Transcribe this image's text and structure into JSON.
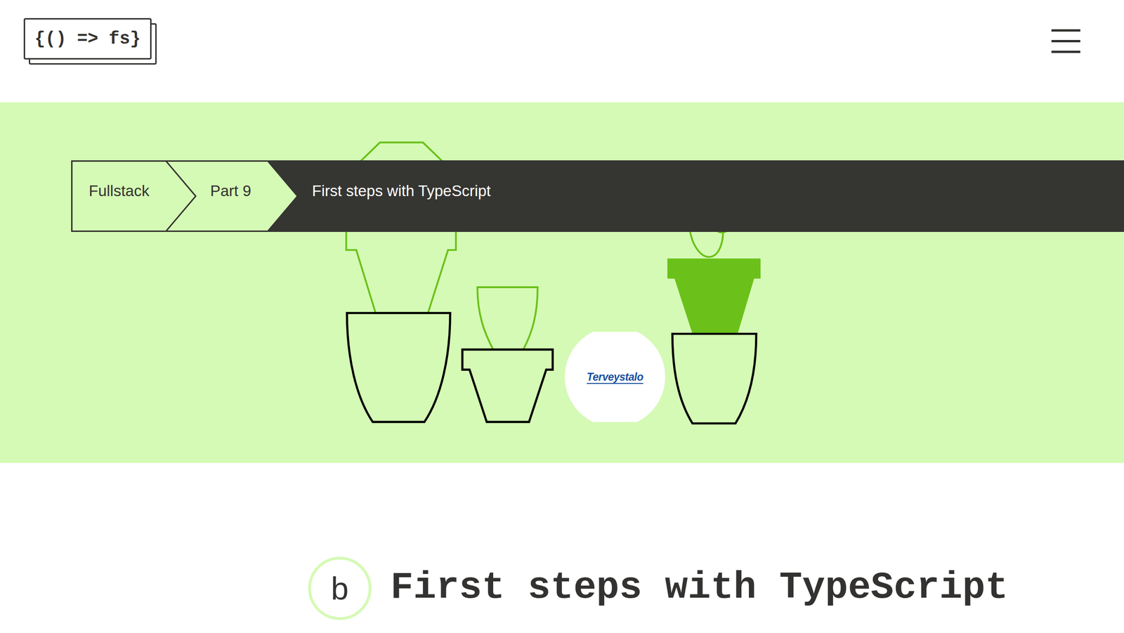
{
  "header": {
    "logo": "{() => fs}"
  },
  "breadcrumb": [
    {
      "label": "Fullstack",
      "selected": false
    },
    {
      "label": "Part 9",
      "selected": false
    },
    {
      "label": "First steps with TypeScript",
      "selected": true
    }
  ],
  "sponsor": {
    "label": "Terveystalo"
  },
  "section": {
    "letter": "b",
    "title": "First steps with TypeScript"
  }
}
